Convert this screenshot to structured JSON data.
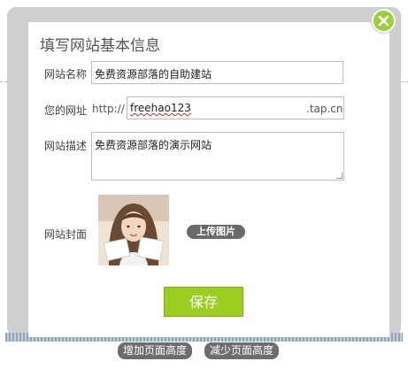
{
  "dialog": {
    "title": "填写网站基本信息",
    "fields": {
      "site_name": {
        "label": "网站名称",
        "value": "免费资源部落的自助建站"
      },
      "site_url": {
        "label": "您的网址",
        "prefix": "http://",
        "value": "freehao123",
        "suffix": ".tap.cn"
      },
      "site_desc": {
        "label": "网站描述",
        "value": "免费资源部落的演示网站"
      },
      "site_cover": {
        "label": "网站封面",
        "upload_label": "上传图片"
      }
    },
    "save_label": "保存"
  },
  "page_buttons": {
    "increase_height": "增加页面高度",
    "decrease_height": "减少页面高度"
  },
  "icons": {
    "close": "close-icon"
  },
  "colors": {
    "accent_green": "#9ccd21",
    "close_green": "#9bcf3b",
    "pill_gray": "#6d6d6d"
  }
}
